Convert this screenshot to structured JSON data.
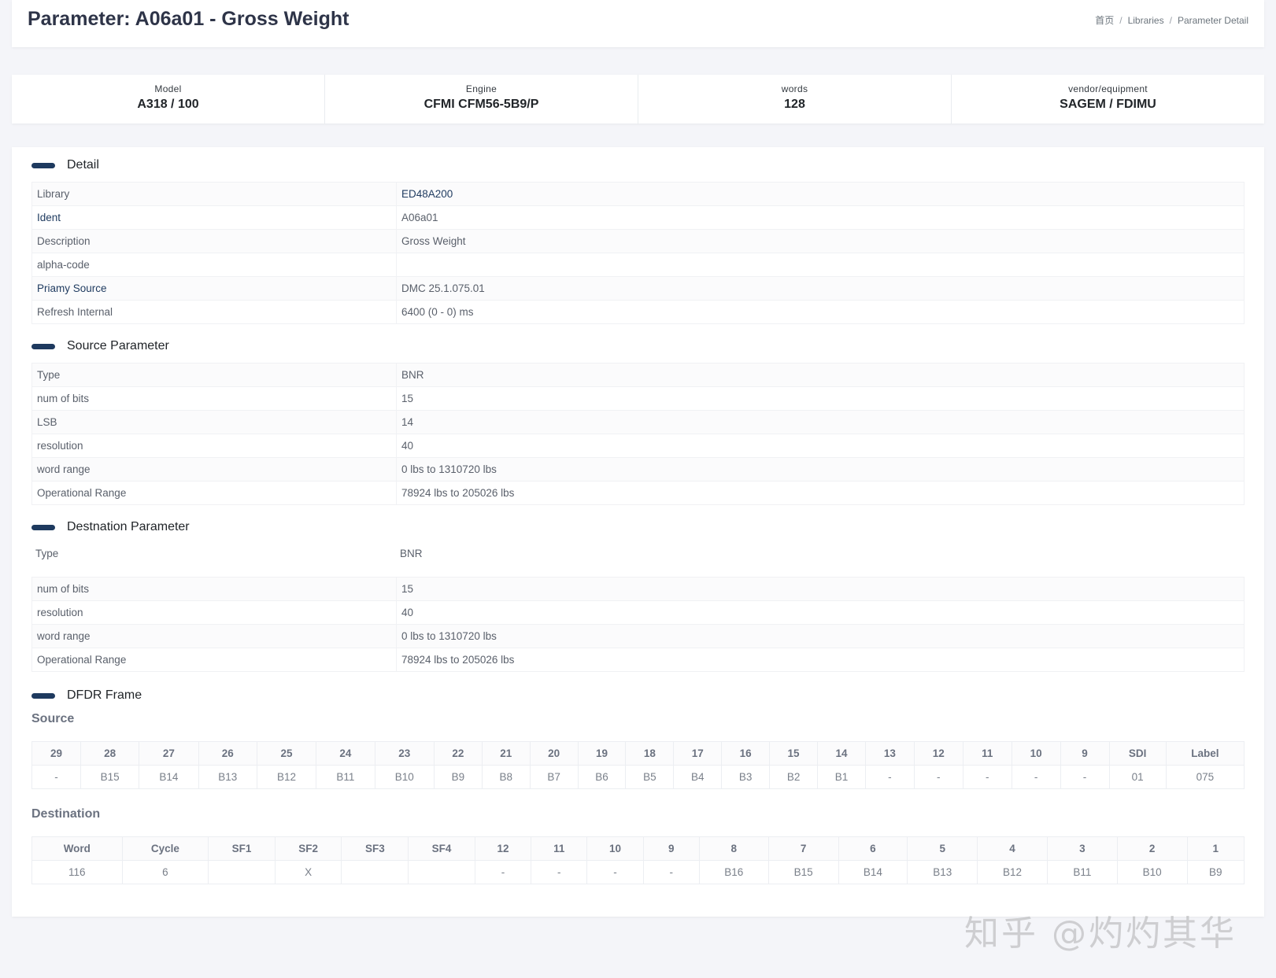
{
  "header": {
    "title": "Parameter: A06a01 - Gross Weight",
    "breadcrumb": [
      "首页",
      "Libraries",
      "Parameter Detail"
    ]
  },
  "summary": [
    {
      "label": "Model",
      "value": "A318 / 100"
    },
    {
      "label": "Engine",
      "value": "CFMI CFM56-5B9/P"
    },
    {
      "label": "words",
      "value": "128"
    },
    {
      "label": "vendor/equipment",
      "value": "SAGEM / FDIMU"
    }
  ],
  "detail": {
    "title": "Detail",
    "rows": [
      {
        "key": "Library",
        "value": "ED48A200"
      },
      {
        "key": "Ident",
        "value": "A06a01"
      },
      {
        "key": "Description",
        "value": "Gross Weight"
      },
      {
        "key": "alpha-code",
        "value": ""
      },
      {
        "key": "Priamy Source",
        "value": "DMC 25.1.075.01"
      },
      {
        "key": "Refresh Internal",
        "value": "6400 (0 - 0) ms"
      }
    ]
  },
  "source_param": {
    "title": "Source Parameter",
    "rows": [
      {
        "key": "Type",
        "value": "BNR"
      },
      {
        "key": "num of bits",
        "value": "15"
      },
      {
        "key": "LSB",
        "value": "14"
      },
      {
        "key": "resolution",
        "value": "40"
      },
      {
        "key": "word range",
        "value": "0 lbs to 1310720 lbs"
      },
      {
        "key": "Operational Range",
        "value": "78924 lbs to 205026 lbs"
      }
    ]
  },
  "dest_param": {
    "title": "Destnation Parameter",
    "type_key": "Type",
    "type_value": "BNR",
    "rows": [
      {
        "key": "num of bits",
        "value": "15"
      },
      {
        "key": "resolution",
        "value": "40"
      },
      {
        "key": "word range",
        "value": "0 lbs to 1310720 lbs"
      },
      {
        "key": "Operational Range",
        "value": "78924 lbs to 205026 lbs"
      }
    ]
  },
  "dfdr": {
    "title": "DFDR Frame",
    "source": {
      "title": "Source",
      "headers": [
        "29",
        "28",
        "27",
        "26",
        "25",
        "24",
        "23",
        "22",
        "21",
        "20",
        "19",
        "18",
        "17",
        "16",
        "15",
        "14",
        "13",
        "12",
        "11",
        "10",
        "9",
        "SDI",
        "Label"
      ],
      "values": [
        "-",
        "B15",
        "B14",
        "B13",
        "B12",
        "B11",
        "B10",
        "B9",
        "B8",
        "B7",
        "B6",
        "B5",
        "B4",
        "B3",
        "B2",
        "B1",
        "-",
        "-",
        "-",
        "-",
        "-",
        "01",
        "075"
      ]
    },
    "destination": {
      "title": "Destination",
      "headers": [
        "Word",
        "Cycle",
        "SF1",
        "SF2",
        "SF3",
        "SF4",
        "12",
        "11",
        "10",
        "9",
        "8",
        "7",
        "6",
        "5",
        "4",
        "3",
        "2",
        "1"
      ],
      "values": [
        "116",
        "6",
        "",
        "X",
        "",
        "",
        "-",
        "-",
        "-",
        "-",
        "B16",
        "B15",
        "B14",
        "B13",
        "B12",
        "B11",
        "B10",
        "B9"
      ]
    }
  },
  "watermark": "知乎 @灼灼其华",
  "colors": {
    "accent": "#1e3a5f",
    "background": "#f4f5f9"
  }
}
